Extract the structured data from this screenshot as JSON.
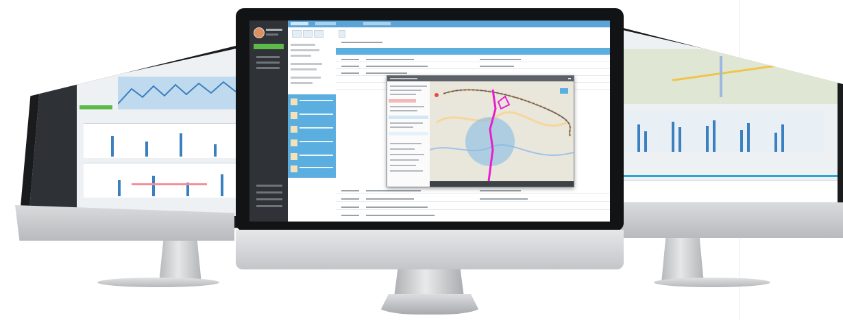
{
  "scene": {
    "monitors": [
      {
        "position": "left",
        "screen": "charts-dashboard"
      },
      {
        "position": "center",
        "screen": "tracking-app-with-map-popup"
      },
      {
        "position": "right",
        "screen": "map-and-bar-charts"
      }
    ]
  },
  "center_app": {
    "sidebar": {
      "active_item_color": "#5cb94a",
      "items_count": 4
    },
    "accent_color": "#5aaee0",
    "map_popup": {
      "zone_color": "#7fb8e6",
      "route_colors": [
        "#e81ecb",
        "#f2a33a",
        "#1d4e9e"
      ]
    }
  },
  "colors": {
    "frame": "#121315",
    "aluminum": "#d6d7d9",
    "accent_blue": "#5aaee0",
    "accent_green": "#5cb94a"
  }
}
